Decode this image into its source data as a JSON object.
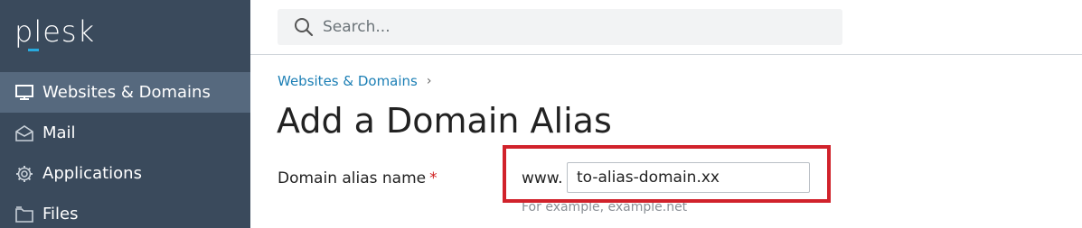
{
  "app": {
    "logo_text": "plesk"
  },
  "sidebar": {
    "items": [
      {
        "label": "Websites & Domains",
        "icon": "monitor-icon",
        "active": true
      },
      {
        "label": "Mail",
        "icon": "mail-icon",
        "active": false
      },
      {
        "label": "Applications",
        "icon": "gear-icon",
        "active": false
      },
      {
        "label": "Files",
        "icon": "folder-icon",
        "active": false
      }
    ]
  },
  "search": {
    "placeholder": "Search..."
  },
  "breadcrumb": {
    "items": [
      {
        "label": "Websites & Domains"
      }
    ],
    "separator": "›"
  },
  "page": {
    "title": "Add a Domain Alias"
  },
  "form": {
    "alias_label": "Domain alias name",
    "required_marker": "*",
    "prefix": "www.",
    "alias_value": "to-alias-domain.xx",
    "hint": "For example, example.net"
  },
  "colors": {
    "sidebar_bg": "#3a4a5c",
    "active_item_bg": "#56697e",
    "link": "#1c7fb5",
    "highlight": "#d1222b",
    "required": "#d02020"
  }
}
